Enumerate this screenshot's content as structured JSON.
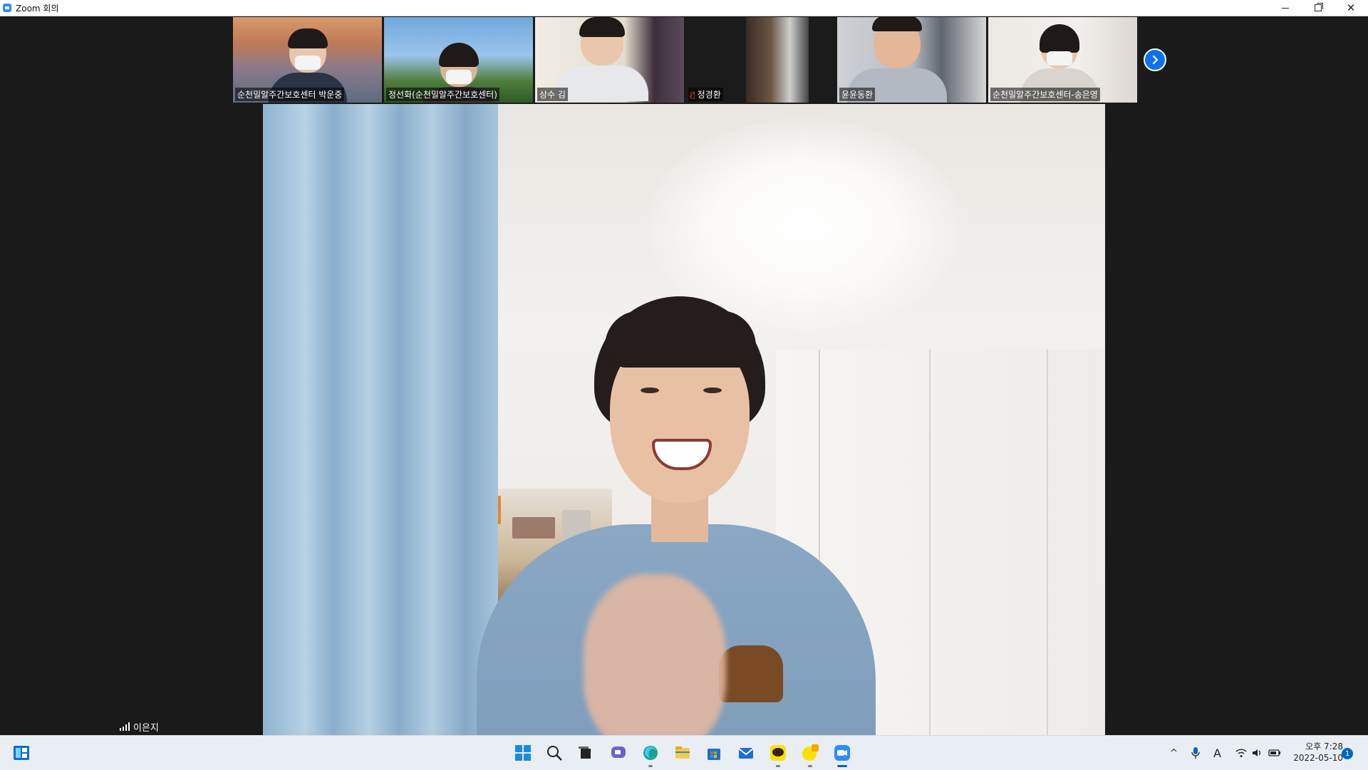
{
  "window": {
    "title": "Zoom 회의",
    "controls": {
      "minimize_icon": "minimize-icon",
      "restore_icon": "restore-icon",
      "close_icon": "close-icon"
    }
  },
  "gallery": {
    "participants": [
      {
        "name": "순천밀알주간보호센터 박운중",
        "muted": false
      },
      {
        "name": "정선화(순천밀알주간보호센터)",
        "muted": false
      },
      {
        "name": "상수 김",
        "muted": false
      },
      {
        "name": "정경환",
        "muted": true
      },
      {
        "name": "윤윤동환",
        "muted": false
      },
      {
        "name": "순천밀알주간보호센터-송은영",
        "muted": false
      }
    ],
    "next_page_icon": "chevron-right-icon"
  },
  "active_speaker": {
    "name": "이은지",
    "connection_icon": "signal-strength-icon"
  },
  "taskbar": {
    "left_icon": "widgets-icon",
    "apps": [
      "windows-start-icon",
      "search-icon",
      "task-view-icon",
      "chat-icon",
      "edge-browser-icon",
      "file-explorer-icon",
      "microsoft-store-icon",
      "mail-icon",
      "kakaotalk-icon",
      "kakaotalk-badge-icon",
      "zoom-icon"
    ],
    "tray": {
      "ime_label": "A",
      "clock_time": "오후 7:28",
      "clock_date": "2022-05-10",
      "notification_count": "1"
    }
  },
  "colors": {
    "zoom_blue": "#0e71eb",
    "mute_red": "#e8463c",
    "background": "#1a1a1a"
  }
}
